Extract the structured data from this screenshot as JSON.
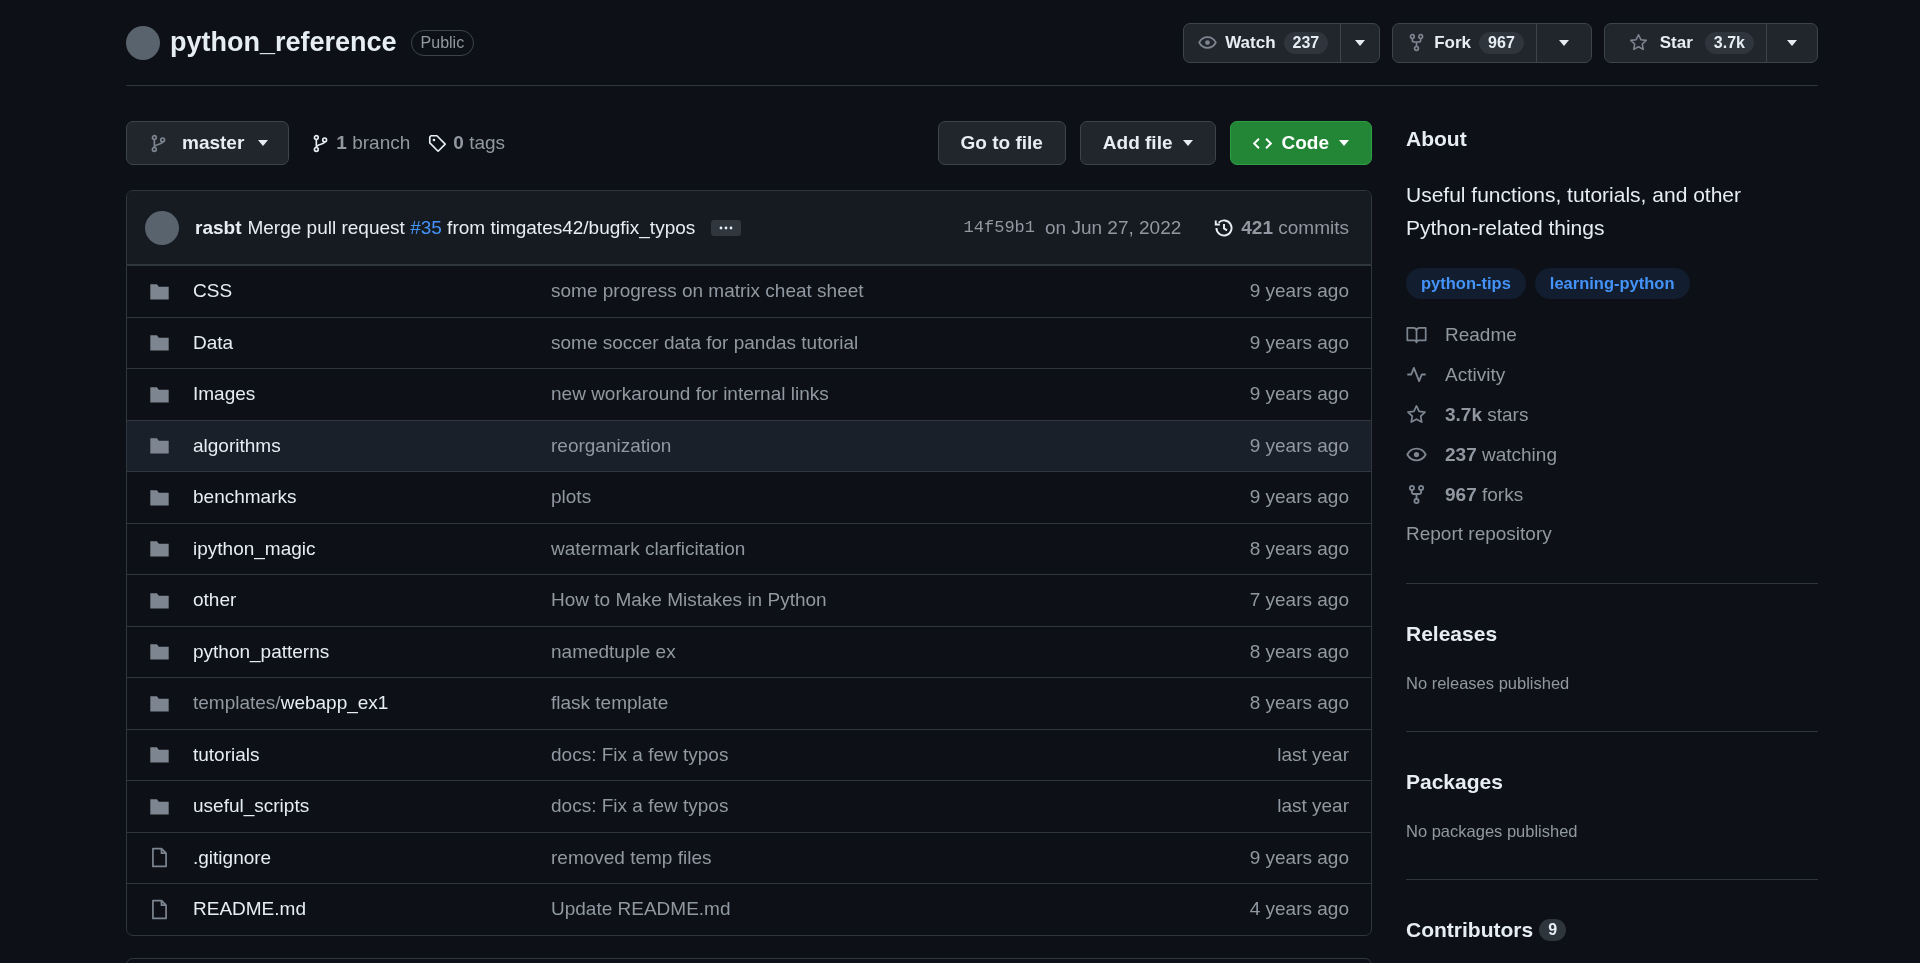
{
  "repo": {
    "name": "python_reference",
    "visibility": "Public"
  },
  "actions": [
    {
      "kind": "watch",
      "label": "Watch",
      "count": "237"
    },
    {
      "kind": "fork",
      "label": "Fork",
      "count": "967"
    },
    {
      "kind": "star",
      "label": "Star",
      "count": "3.7k"
    }
  ],
  "toolbar": {
    "branch": "master",
    "branches": "**1** branch",
    "tags": "**0** tags",
    "go_to_file": "Go to file",
    "add_file": "Add file",
    "code": "Code"
  },
  "commit": {
    "author": "rasbt",
    "message_start": "Merge pull request ",
    "pr_link": "#35",
    "message_end": " from timgates42/bugfix_typos",
    "hash": "14f59b1",
    "date": "on Jun 27, 2022",
    "commits": "**421** commits"
  },
  "files": [
    {
      "kind": "folder",
      "name": "CSS",
      "message": "some progress on matrix cheat sheet",
      "age": "9 years ago",
      "hovered": false
    },
    {
      "kind": "folder",
      "name": "Data",
      "message": "some soccer data for pandas tutorial",
      "age": "9 years ago",
      "hovered": false
    },
    {
      "kind": "folder",
      "name": "Images",
      "message": "new workaround for internal links",
      "age": "9 years ago",
      "hovered": false
    },
    {
      "kind": "folder",
      "name": "algorithms",
      "message": "reorganization",
      "age": "9 years ago",
      "hovered": true
    },
    {
      "kind": "folder",
      "name": "benchmarks",
      "message": "plots",
      "age": "9 years ago",
      "hovered": false
    },
    {
      "kind": "folder",
      "name": "ipython_magic",
      "message": "watermark clarficitation",
      "age": "8 years ago",
      "hovered": false
    },
    {
      "kind": "folder",
      "name": "other",
      "message": "How to Make Mistakes in Python",
      "age": "7 years ago",
      "hovered": false
    },
    {
      "kind": "folder",
      "name": "python_patterns",
      "message": "namedtuple ex",
      "age": "8 years ago",
      "hovered": false
    },
    {
      "kind": "folder",
      "name_prefix": "templates/",
      "name": "webapp_ex1",
      "message": "flask template",
      "age": "8 years ago",
      "hovered": false
    },
    {
      "kind": "folder",
      "name": "tutorials",
      "message": "docs: Fix a few typos",
      "age": "last year",
      "hovered": false
    },
    {
      "kind": "folder",
      "name": "useful_scripts",
      "message": "docs: Fix a few typos",
      "age": "last year",
      "hovered": false
    },
    {
      "kind": "file",
      "name": ".gitignore",
      "message": "removed temp files",
      "age": "9 years ago",
      "hovered": false
    },
    {
      "kind": "file",
      "name": "README.md",
      "message": "Update README.md",
      "age": "4 years ago",
      "hovered": false
    }
  ],
  "about": {
    "title": "About",
    "description": "Useful functions, tutorials, and other Python-related things",
    "topics": [
      "python-tips",
      "learning-python"
    ],
    "links": [
      {
        "kind": "readme",
        "text": "Readme"
      },
      {
        "kind": "activity",
        "text": "Activity"
      },
      {
        "kind": "stars",
        "text": "**3.7k** stars"
      },
      {
        "kind": "watching",
        "text": "**237** watching"
      },
      {
        "kind": "forks",
        "text": "**967** forks"
      }
    ],
    "report": "Report repository"
  },
  "sections": [
    {
      "title": "Releases",
      "note": "No releases published"
    },
    {
      "title": "Packages",
      "note": "No packages published"
    }
  ],
  "contributors": {
    "title": "Contributors",
    "count": "9"
  }
}
